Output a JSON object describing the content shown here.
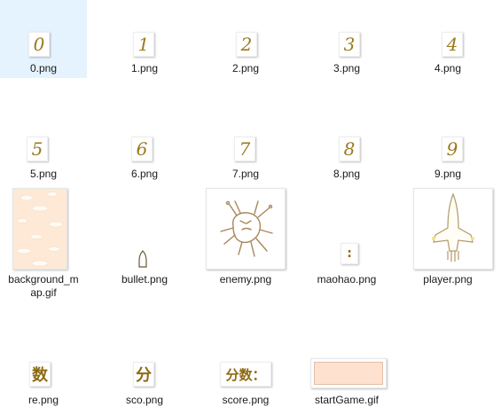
{
  "files": [
    {
      "name": "0.png",
      "glyph": "0"
    },
    {
      "name": "1.png",
      "glyph": "1"
    },
    {
      "name": "2.png",
      "glyph": "2"
    },
    {
      "name": "3.png",
      "glyph": "3"
    },
    {
      "name": "4.png",
      "glyph": "4"
    },
    {
      "name": "5.png",
      "glyph": "5"
    },
    {
      "name": "6.png",
      "glyph": "6"
    },
    {
      "name": "7.png",
      "glyph": "7"
    },
    {
      "name": "8.png",
      "glyph": "8"
    },
    {
      "name": "9.png",
      "glyph": "9"
    },
    {
      "name": "background_map.gif",
      "label_line1": "background_m",
      "label_line2": "ap.gif"
    },
    {
      "name": "bullet.png"
    },
    {
      "name": "enemy.png"
    },
    {
      "name": "maohao.png",
      "glyph": ":"
    },
    {
      "name": "player.png"
    },
    {
      "name": "re.png",
      "glyph": "数"
    },
    {
      "name": "sco.png",
      "glyph": "分"
    },
    {
      "name": "score.png",
      "glyph": "分数："
    },
    {
      "name": "startGame.gif"
    }
  ],
  "colors": {
    "selection": "#e5f3ff",
    "glyph": "#9a7a1e",
    "sketch": "#a9875a",
    "start_fill": "#ffe1cf"
  }
}
